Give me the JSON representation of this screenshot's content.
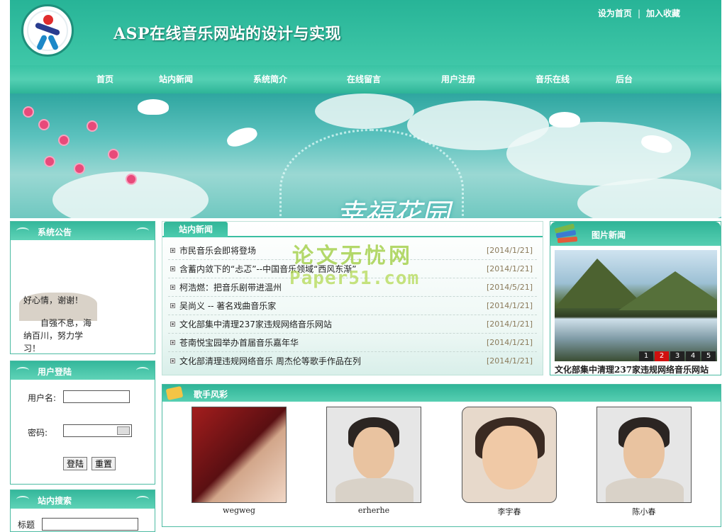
{
  "header": {
    "title": "ASP在线音乐网站的设计与实现",
    "set_home": "设为首页",
    "separator": "|",
    "add_fav": "加入收藏"
  },
  "nav": [
    "首页",
    "站内新闻",
    "系统简介",
    "在线留言",
    "用户注册",
    "音乐在线",
    "后台"
  ],
  "banner": {
    "script_text": "幸福花园"
  },
  "announce": {
    "title": "系统公告",
    "line1": "好心情，谢谢！",
    "line2": "自强不息，海纳百川，努力学习！"
  },
  "login": {
    "title": "用户登陆",
    "username_label": "用户名:",
    "password_label": "密码:",
    "submit": "登陆",
    "reset": "重置"
  },
  "search": {
    "title": "站内搜索",
    "label": "标题"
  },
  "news": {
    "tab": "站内新闻",
    "items": [
      {
        "title": "市民音乐会即将登场",
        "date": "[2014/1/21]"
      },
      {
        "title": "含蓄内敛下的“忐忑”--中国音乐领域“西风东渐”",
        "date": "[2014/1/21]"
      },
      {
        "title": "柯浩燃：把音乐剧带进温州",
        "date": "[2014/5/21]"
      },
      {
        "title": "吴尚义 -- 著名戏曲音乐家",
        "date": "[2014/1/21]"
      },
      {
        "title": "文化部集中清理237家违规网络音乐网站",
        "date": "[2014/1/21]"
      },
      {
        "title": "苍南悦宝园举办首届音乐嘉年华",
        "date": "[2014/1/21]"
      },
      {
        "title": "文化部清理违规网络音乐 周杰伦等歌手作品在列",
        "date": "[2014/1/21]"
      }
    ]
  },
  "watermark": {
    "line1": "论文无忧网",
    "line2": "Paper51.com"
  },
  "picnews": {
    "title": "图片新闻",
    "pages": [
      "1",
      "2",
      "3",
      "4",
      "5"
    ],
    "active_page": "2",
    "caption": "文化部集中清理237家违规网络音乐网站"
  },
  "singers": {
    "title": "歌手风彩",
    "items": [
      {
        "name": "wegweg"
      },
      {
        "name": "erherhe"
      },
      {
        "name": "李宇春"
      },
      {
        "name": "陈小春"
      }
    ]
  },
  "colors": {
    "primary": "#27b497",
    "nav": "#3fc7a8",
    "pager_active": "#d10f0f"
  }
}
